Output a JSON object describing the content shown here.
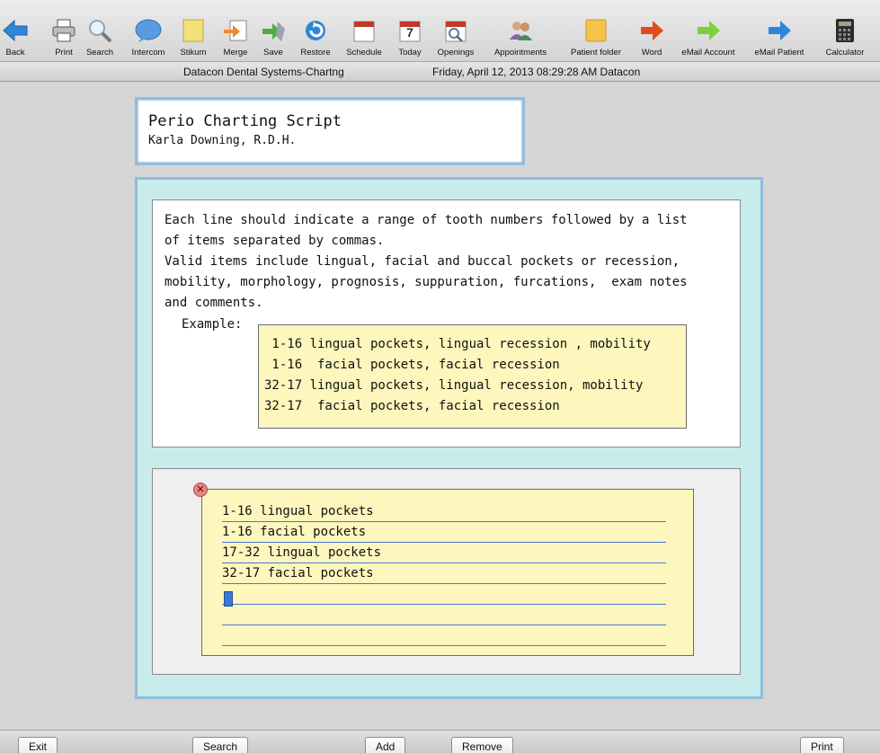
{
  "toolbar": {
    "items": [
      {
        "label": "Back",
        "icon": "back-arrow-icon"
      },
      {
        "label": "Print",
        "icon": "printer-icon"
      },
      {
        "label": "Search",
        "icon": "magnifier-icon"
      },
      {
        "label": "Intercom",
        "icon": "speech-bubble-icon"
      },
      {
        "label": "Stikum",
        "icon": "sticky-note-icon"
      },
      {
        "label": "Merge",
        "icon": "merge-icon"
      },
      {
        "label": "Save",
        "icon": "save-icon"
      },
      {
        "label": "Restore",
        "icon": "restore-icon"
      },
      {
        "label": "Schedule",
        "icon": "calendar-icon"
      },
      {
        "label": "Today",
        "icon": "today-calendar-icon"
      },
      {
        "label": "Openings",
        "icon": "openings-calendar-icon"
      },
      {
        "label": "Appointments",
        "icon": "people-icon"
      },
      {
        "label": "Patient folder",
        "icon": "folder-icon"
      },
      {
        "label": "Word",
        "icon": "word-arrow-icon"
      },
      {
        "label": "eMail Account",
        "icon": "email-account-arrow-icon"
      },
      {
        "label": "eMail Patient",
        "icon": "email-patient-arrow-icon"
      },
      {
        "label": "Calculator",
        "icon": "calculator-icon"
      }
    ],
    "today_day": "7"
  },
  "status": {
    "app": "Datacon Dental Systems-Chartng",
    "datetime": "Friday, April 12, 2013  08:29:28 AM  Datacon"
  },
  "header": {
    "title": "Perio Charting Script",
    "subtitle": "Karla Downing, R.D.H."
  },
  "instructions": {
    "lines": [
      "Each line should indicate a range of tooth numbers followed by a list",
      "of items separated by commas.",
      "Valid items include lingual, facial and buccal pockets or recession,",
      "mobility, morphology, prognosis, suppuration, furcations,  exam notes",
      "and comments."
    ],
    "example_label": "Example:",
    "example_lines": [
      " 1-16 lingual pockets, lingual recession , mobility",
      " 1-16  facial pockets, facial recession",
      "32-17 lingual pockets, lingual recession, mobility",
      "32-17  facial pockets, facial recession"
    ]
  },
  "note": {
    "close_glyph": "✕",
    "lines": [
      "1-16 lingual pockets",
      "1-16 facial pockets",
      "17-32 lingual pockets",
      "32-17 facial pockets",
      "",
      "",
      ""
    ]
  },
  "bottom": {
    "exit": "Exit",
    "search": "Search",
    "add": "Add",
    "remove": "Remove",
    "print": "Print"
  },
  "colors": {
    "panel_bg": "#c8ecec",
    "panel_border": "#8fbde0",
    "note_bg": "#fdf6bd",
    "line_blue": "#4a78d8"
  }
}
